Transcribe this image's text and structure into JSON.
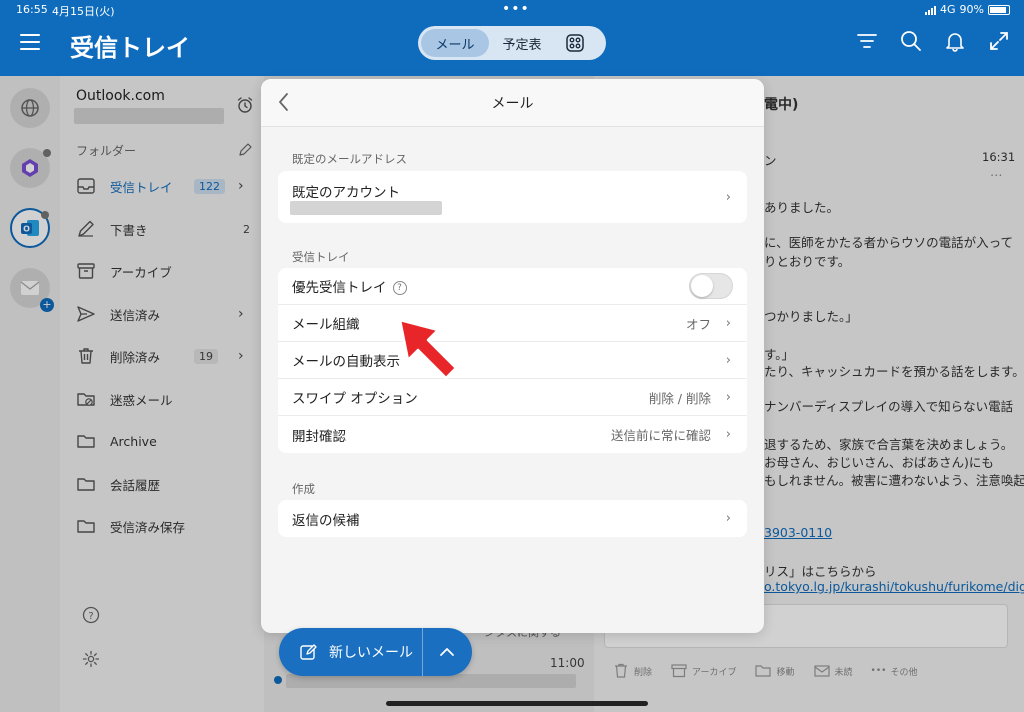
{
  "status": {
    "time": "16:55",
    "date": "4月15日(火)",
    "network": "4G",
    "battery": "90%"
  },
  "header": {
    "title": "受信トレイ",
    "tabs": [
      {
        "label": "メール",
        "active": true
      },
      {
        "label": "予定表",
        "active": false
      }
    ]
  },
  "folders": {
    "account": "Outlook.com",
    "section_title": "フォルダー",
    "items": [
      {
        "label": "受信トレイ",
        "count": "122",
        "icon": "inbox-icon",
        "chevron": true,
        "selected": true
      },
      {
        "label": "下書き",
        "count": "2",
        "icon": "drafts-icon",
        "chevron": false
      },
      {
        "label": "アーカイブ",
        "count": "",
        "icon": "archive-icon",
        "chevron": false
      },
      {
        "label": "送信済み",
        "count": "",
        "icon": "send-icon",
        "chevron": true
      },
      {
        "label": "削除済み",
        "count": "19",
        "icon": "trash-icon",
        "chevron": true
      },
      {
        "label": "迷惑メール",
        "count": "",
        "icon": "junk-icon",
        "chevron": false
      },
      {
        "label": "Archive",
        "count": "",
        "icon": "folder-icon",
        "chevron": false
      },
      {
        "label": "会話履歴",
        "count": "",
        "icon": "folder-icon",
        "chevron": false
      },
      {
        "label": "受信済み保存",
        "count": "",
        "icon": "folder-icon",
        "chevron": false
      }
    ]
  },
  "message_list": {
    "snippet": "ンタスに関する",
    "time": "11:00"
  },
  "reading": {
    "subject_fragment": "電中)",
    "sender_fragment": "ン",
    "time": "16:31",
    "lines": [
      "ありました。",
      "に、医師をかたる者からウソの電話が入って",
      "りとおりです。",
      "つかりました。」",
      "す。」",
      "たり、キャッシュカードを預かる話をします。",
      "ナンバーディスプレイの導入で知らない電話",
      "退するため、家族で合言葉を決めましょう。",
      "お母さん、おじいさん、おばあさん)にも",
      "もしれません。被害に遭わないよう、注意喚起"
    ],
    "phone_link": "3903-0110",
    "list_line": "リス」はこちらから",
    "url_link": "o.tokyo.lg.jp/kurashi/tokushu/furikome/dig",
    "actions": [
      "削除",
      "アーカイブ",
      "移動",
      "未読",
      "その他"
    ]
  },
  "modal": {
    "title": "メール",
    "sections": [
      {
        "title": "既定のメールアドレス",
        "rows": [
          {
            "label": "既定のアカウント",
            "value": ""
          }
        ]
      },
      {
        "title": "受信トレイ",
        "rows": [
          {
            "label": "優先受信トレイ",
            "toggle": false
          },
          {
            "label": "メール組織",
            "value": "オフ"
          },
          {
            "label": "メールの自動表示",
            "value": ""
          },
          {
            "label": "スワイプ オプション",
            "value": "削除 / 削除"
          },
          {
            "label": "開封確認",
            "value": "送信前に常に確認"
          }
        ]
      },
      {
        "title": "作成",
        "rows": [
          {
            "label": "返信の候補",
            "value": ""
          }
        ]
      }
    ]
  },
  "compose": {
    "label": "新しいメール"
  },
  "colors": {
    "brand": "#0f6cbd",
    "arrow": "#e8262a"
  }
}
